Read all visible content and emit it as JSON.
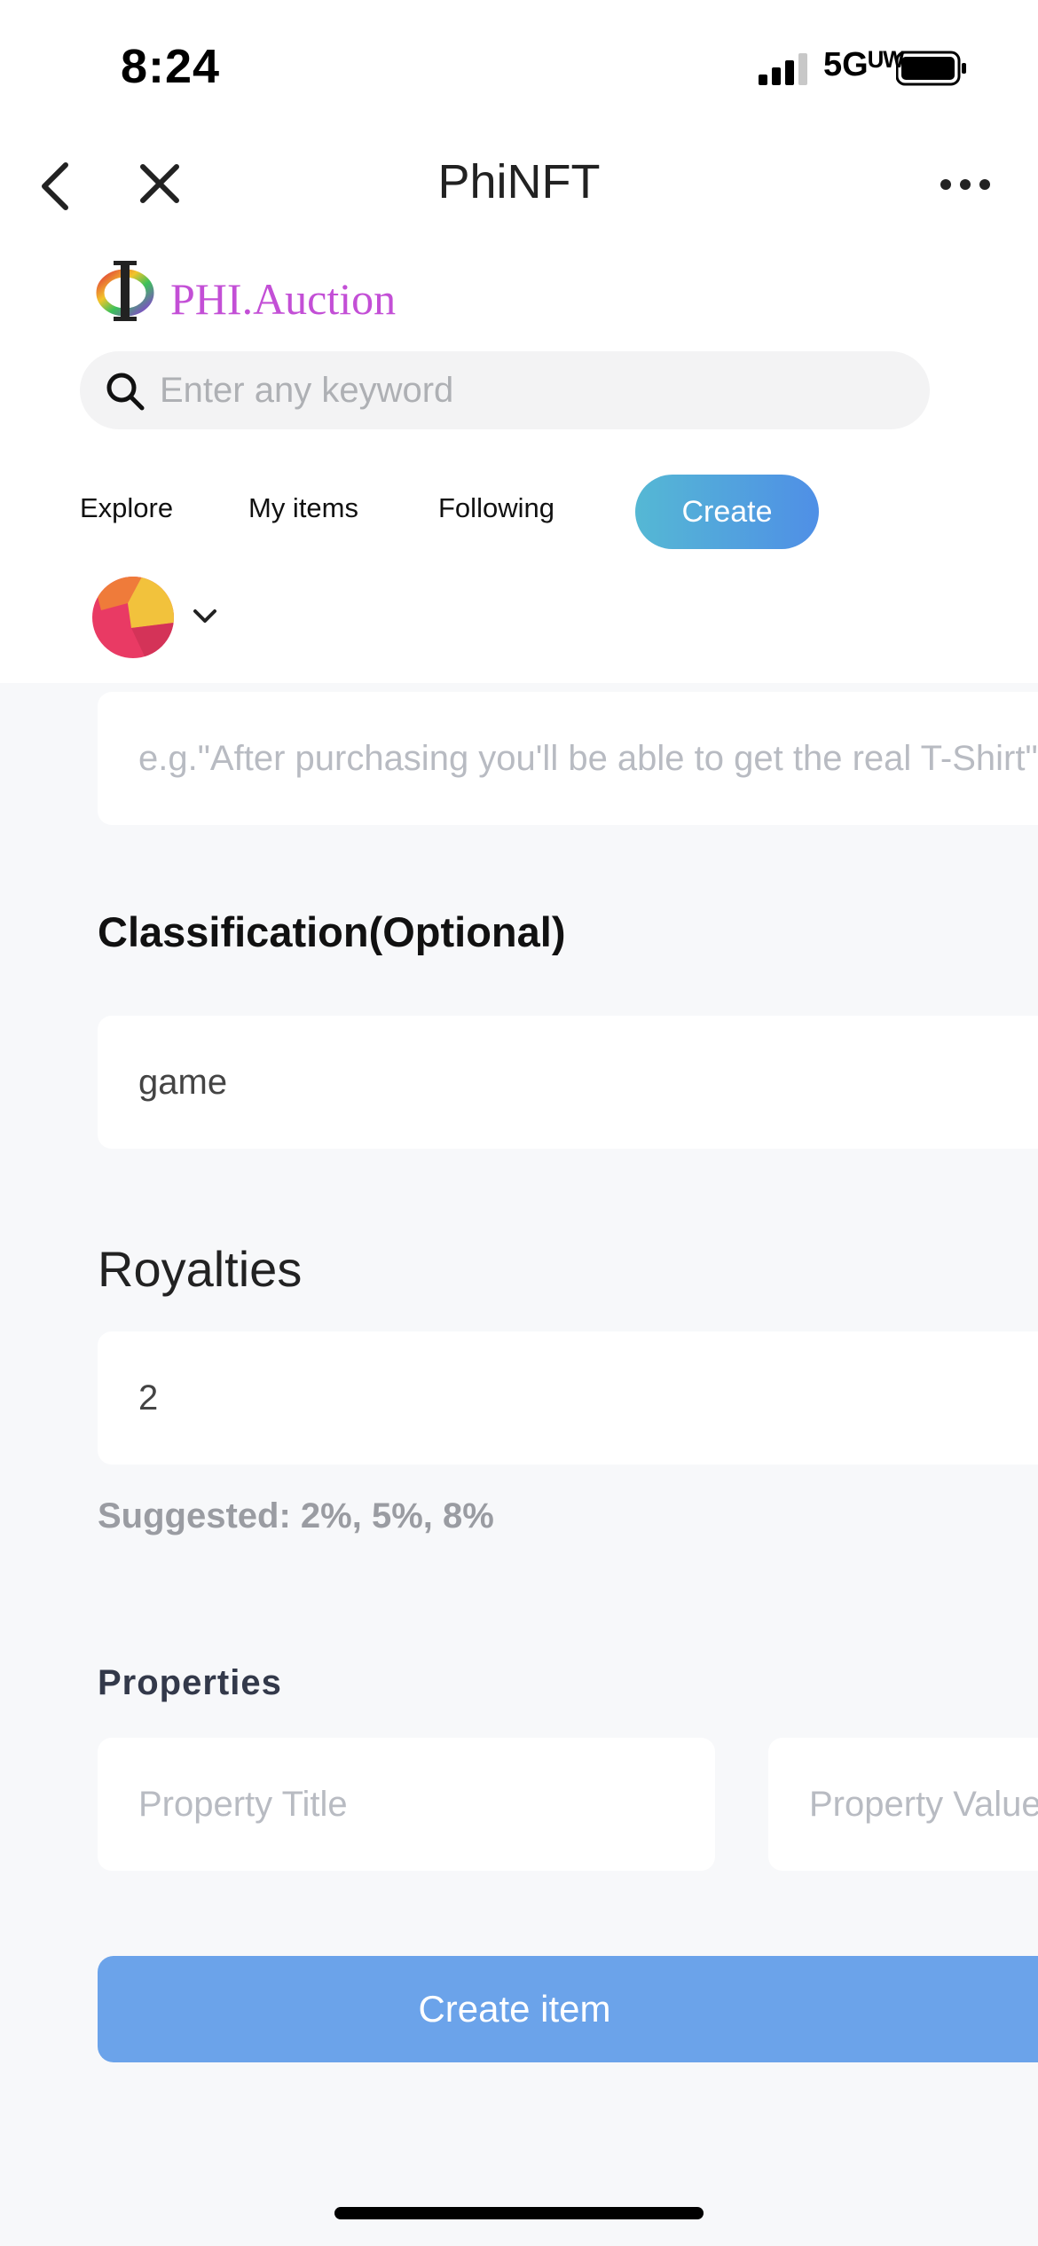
{
  "status_bar": {
    "time": "8:24",
    "network": "5Gᵁᵂ"
  },
  "nav": {
    "title": "PhiNFT"
  },
  "brand": {
    "name": "PHI.Auction"
  },
  "search": {
    "placeholder": "Enter any keyword"
  },
  "tabs": {
    "explore": "Explore",
    "my_items": "My items",
    "following": "Following",
    "create": "Create"
  },
  "form": {
    "description_placeholder": "e.g.\"After purchasing you'll be able to get the real T-Shirt\"",
    "classification_label": "Classification(Optional)",
    "classification_value": "game",
    "royalties_label": "Royalties",
    "royalties_value": "2",
    "royalties_hint": "Suggested: 2%, 5%, 8%",
    "properties_label": "Properties",
    "property_title_placeholder": "Property Title",
    "property_value_placeholder": "Property Value",
    "submit_label": "Create item"
  },
  "colors": {
    "brand": "#c34fd6",
    "create_gradient_start": "#55b8d4",
    "create_gradient_end": "#4f8fe6",
    "submit": "#6ba3ea"
  }
}
